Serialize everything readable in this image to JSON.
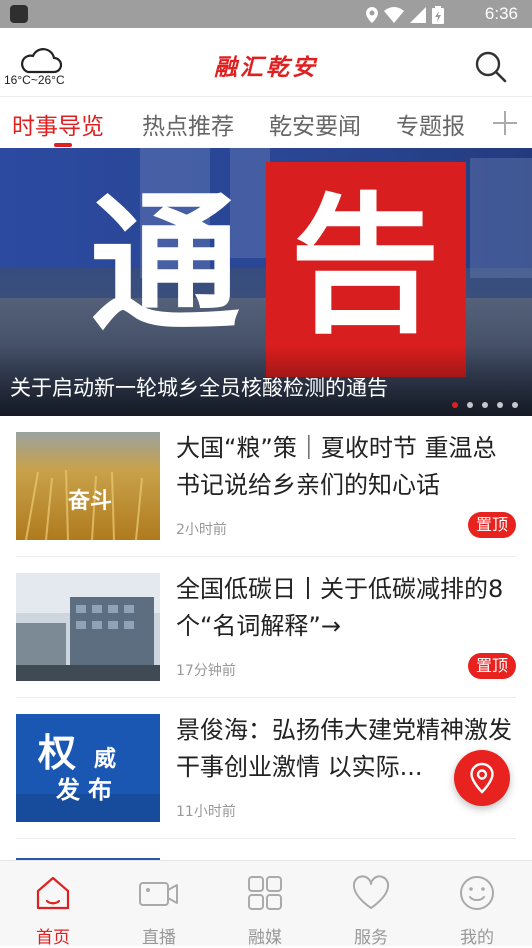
{
  "status_bar": {
    "time": "6:36"
  },
  "header": {
    "weather": "16°C~26°C",
    "title": "融汇乾安",
    "icons": {
      "weather": "cloud-icon",
      "search": "search-icon"
    }
  },
  "tabs": [
    {
      "label": "时事导览",
      "active": true
    },
    {
      "label": "热点推荐",
      "active": false
    },
    {
      "label": "乾安要闻",
      "active": false
    },
    {
      "label": "专题报",
      "active": false
    }
  ],
  "banner": {
    "big_text_left": "通",
    "big_text_right": "告",
    "caption": "关于启动新一轮城乡全员核酸检测的通告",
    "slide_count": 5,
    "active_slide": 1
  },
  "news": [
    {
      "title": "大国“粮”策｜夏收时节 重温总书记说给乡亲们的知心话",
      "time": "2小时前",
      "badge": "置顶",
      "thumb_text": "奋斗"
    },
    {
      "title": "全国低碳日丨关于低碳减排的8个“名词解释”→",
      "time": "17分钟前",
      "badge": "置顶",
      "thumb_text": ""
    },
    {
      "title": "景俊海：弘扬伟大建党精神激发干事创业激情 以实际...",
      "time": "11小时前",
      "badge": "",
      "thumb_text": "权威发布",
      "thumb_words": [
        "权",
        "威",
        "发",
        "布"
      ]
    }
  ],
  "bottom_nav": [
    {
      "label": "首页",
      "icon": "home-icon",
      "active": true
    },
    {
      "label": "直播",
      "icon": "video-camera-icon",
      "active": false
    },
    {
      "label": "融媒",
      "icon": "grid-icon",
      "active": false
    },
    {
      "label": "服务",
      "icon": "heart-icon",
      "active": false
    },
    {
      "label": "我的",
      "icon": "smiley-icon",
      "active": false
    }
  ],
  "colors": {
    "accent": "#e02020",
    "banner_blue": "#22408b",
    "badge_red": "#e8221f"
  }
}
